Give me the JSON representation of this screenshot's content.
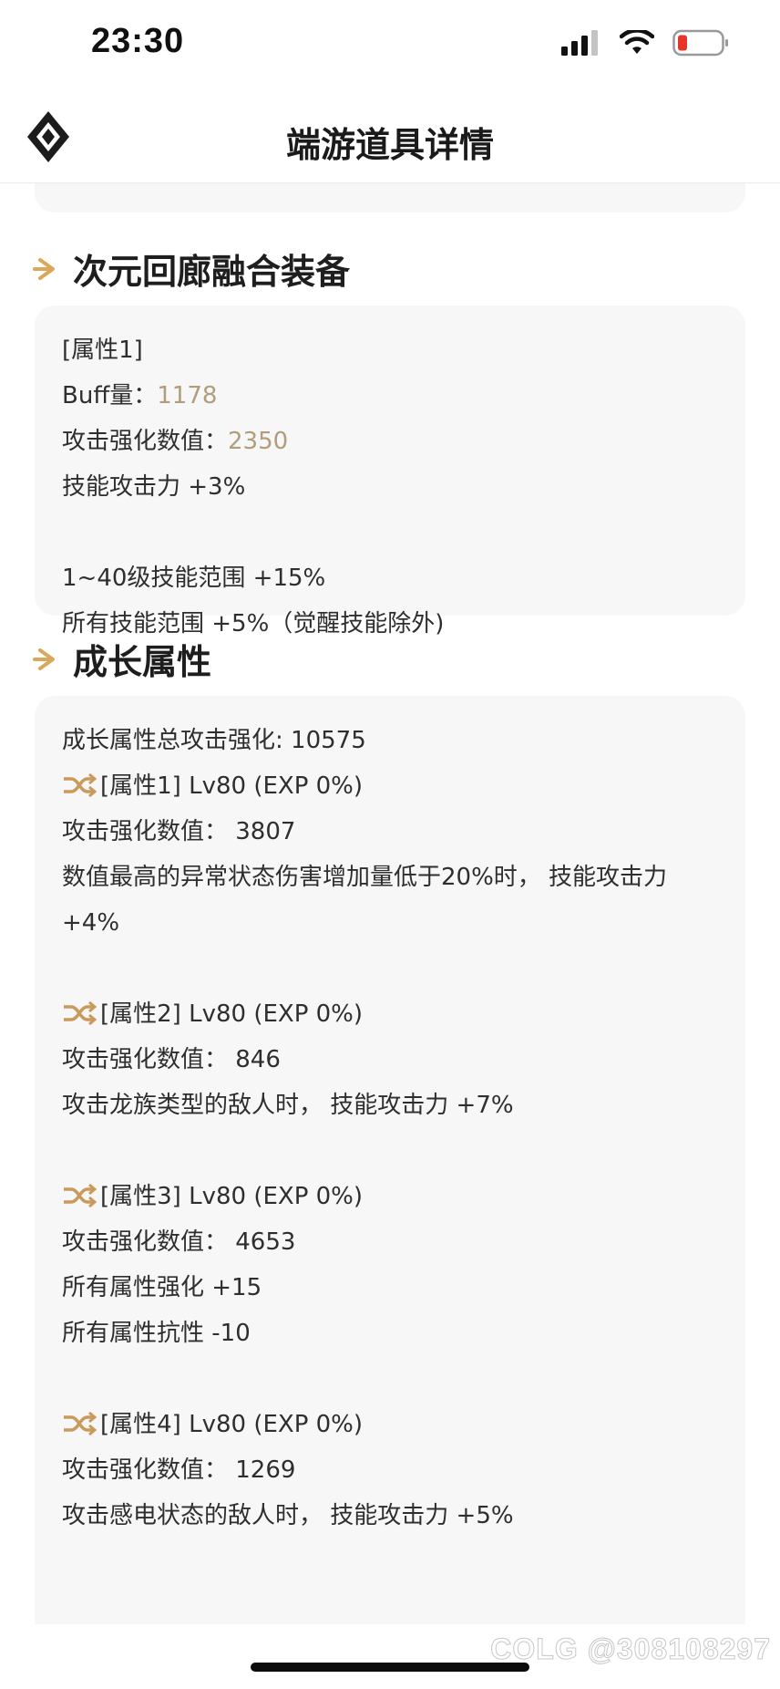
{
  "status_bar": {
    "time": "23:30",
    "icons": [
      "signal-icon",
      "wifi-icon",
      "battery-icon"
    ]
  },
  "header": {
    "title": "端游道具详情",
    "logo_icon": "diamond-logo-icon"
  },
  "sections": [
    {
      "title": "次元回廊融合装备",
      "lines": [
        {
          "text": "[属性1]"
        },
        {
          "label": "Buff量：",
          "value": "1178"
        },
        {
          "label": "攻击强化数值：",
          "value": "2350"
        },
        {
          "text": "技能攻击力 +3%"
        },
        {
          "text": ""
        },
        {
          "text": "1~40级技能范围 +15%"
        },
        {
          "text": "所有技能范围 +5%（觉醒技能除外)"
        }
      ]
    },
    {
      "title": "成长属性",
      "total": "成长属性总攻击强化: 10575",
      "attrs": [
        {
          "header": "[属性1] Lv80 (EXP 0%)",
          "lines": [
            "攻击强化数值： 3807",
            "数值最高的异常状态伤害增加量低于20%时， 技能攻击力 +4%"
          ]
        },
        {
          "header": "[属性2] Lv80 (EXP 0%)",
          "lines": [
            "攻击强化数值： 846",
            "攻击龙族类型的敌人时， 技能攻击力 +7%"
          ]
        },
        {
          "header": "[属性3] Lv80 (EXP 0%)",
          "lines": [
            "攻击强化数值： 4653",
            "所有属性强化 +15",
            "所有属性抗性 -10"
          ]
        },
        {
          "header": "[属性4] Lv80 (EXP 0%)",
          "lines": [
            "攻击强化数值： 1269",
            "攻击感电状态的敌人时， 技能攻击力 +5%"
          ]
        }
      ]
    }
  ],
  "watermark": "COLG @308108297",
  "colors": {
    "accent_gold": "#d9a85a",
    "value_gold": "#b19d7c",
    "card_bg": "#f7f7f7"
  }
}
